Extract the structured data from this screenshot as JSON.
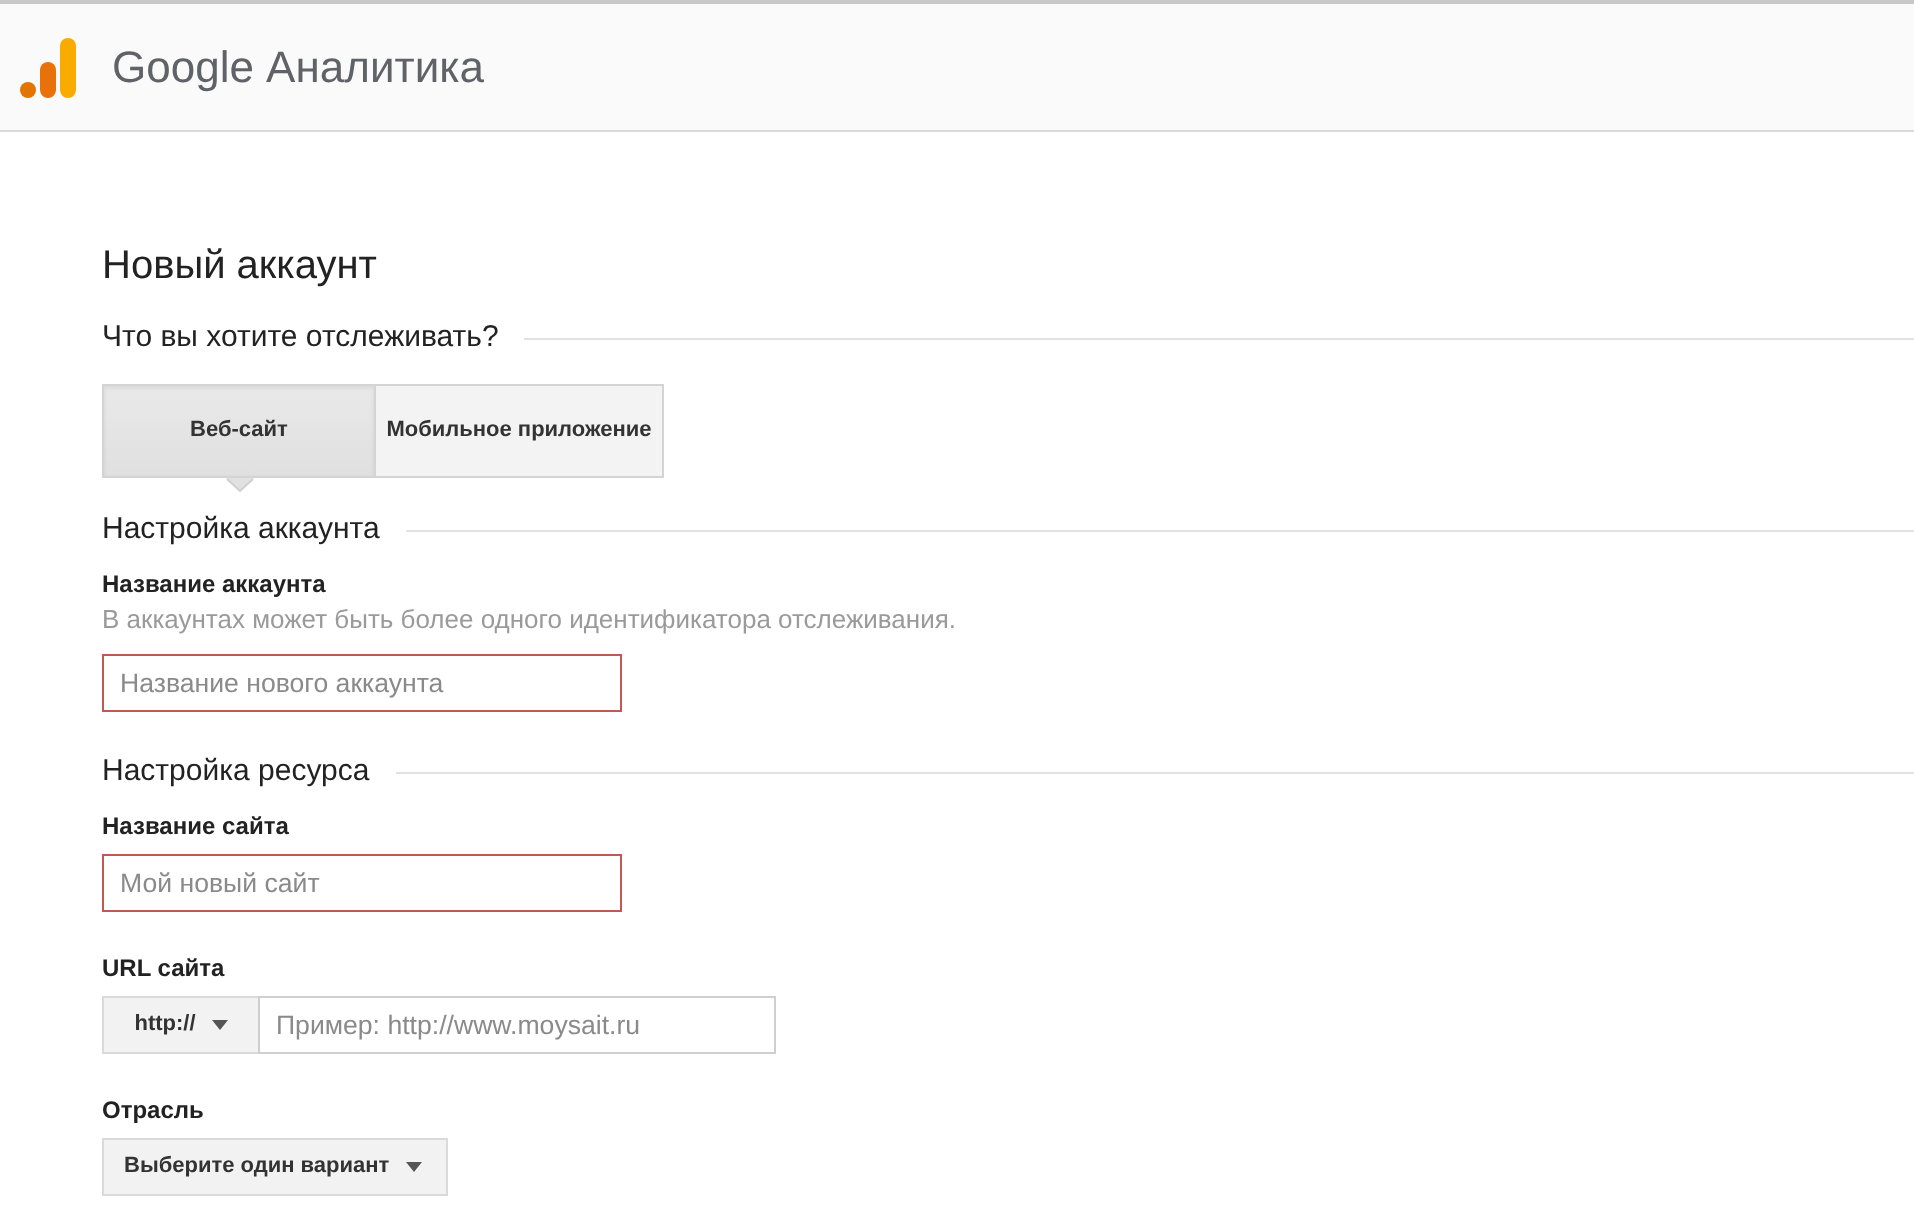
{
  "header": {
    "product_title": "Google Аналитика"
  },
  "page_title": "Новый аккаунт",
  "tracking": {
    "heading": "Что вы хотите отслеживать?",
    "options": [
      {
        "label": "Веб-сайт",
        "selected": true
      },
      {
        "label": "Мобильное приложение",
        "selected": false
      }
    ]
  },
  "sections": [
    {
      "heading": "Настройка аккаунта",
      "fields": [
        {
          "kind": "text",
          "label": "Название аккаунта",
          "hint": "В аккаунтах может быть более одного идентификатора отслеживания.",
          "placeholder": "Название нового аккаунта",
          "invalid": true
        }
      ]
    },
    {
      "heading": "Настройка ресурса",
      "fields": [
        {
          "kind": "text",
          "label": "Название сайта",
          "placeholder": "Мой новый сайт",
          "invalid": true
        },
        {
          "kind": "url",
          "label": "URL сайта",
          "protocol": "http://",
          "placeholder": "Пример: http://www.moysait.ru",
          "invalid": false
        },
        {
          "kind": "select",
          "label": "Отрасль",
          "value": "Выберите один вариант"
        }
      ]
    }
  ]
}
